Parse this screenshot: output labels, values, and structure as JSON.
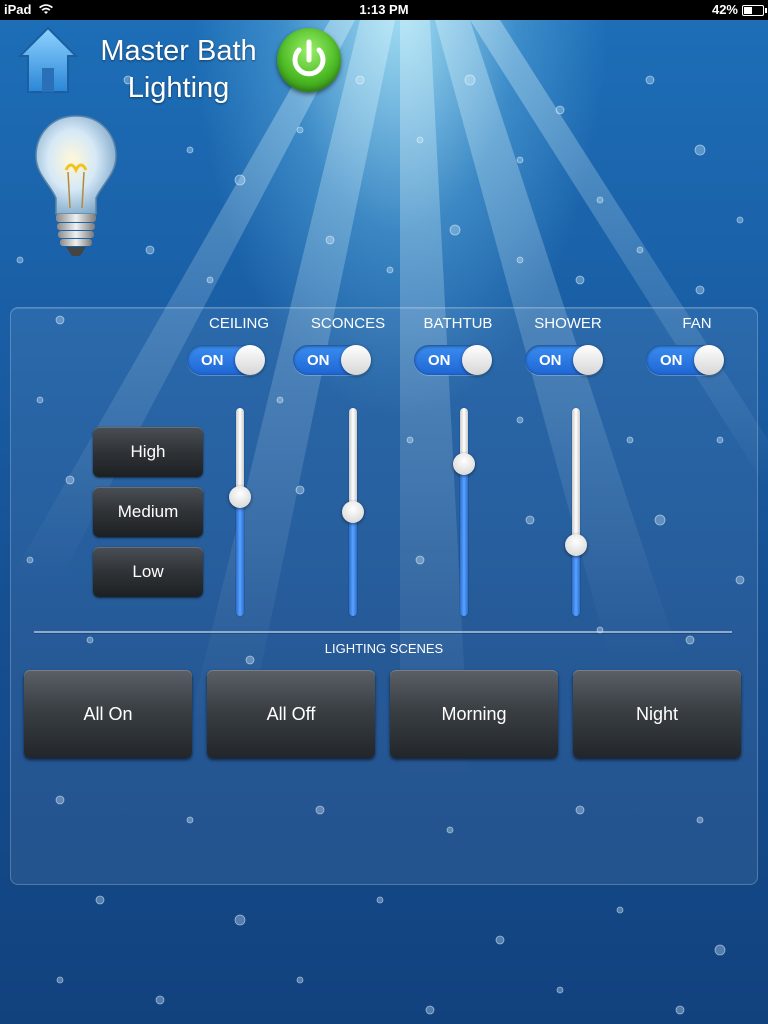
{
  "status_bar": {
    "device": "iPad",
    "time": "1:13 PM",
    "battery": "42%",
    "battery_level": 0.42
  },
  "header": {
    "title_line1": "Master Bath",
    "title_line2": "Lighting",
    "home_icon": "home-icon",
    "power_icon": "power-icon",
    "bulb_icon": "light-bulb-icon"
  },
  "channels": [
    {
      "label": "CEILING",
      "switch": "ON",
      "level": 0.58
    },
    {
      "label": "SCONCES",
      "switch": "ON",
      "level": 0.5
    },
    {
      "label": "BATHTUB",
      "switch": "ON",
      "level": 0.76
    },
    {
      "label": "SHOWER",
      "switch": "ON",
      "level": 0.32
    },
    {
      "label": "FAN",
      "switch": "ON"
    }
  ],
  "levels": {
    "high": "High",
    "medium": "Medium",
    "low": "Low"
  },
  "scenes": {
    "label": "LIGHTING SCENES",
    "buttons": [
      "All On",
      "All Off",
      "Morning",
      "Night"
    ]
  },
  "colors": {
    "accent_blue": "#1e66d4",
    "power_green": "#4dbb25"
  }
}
